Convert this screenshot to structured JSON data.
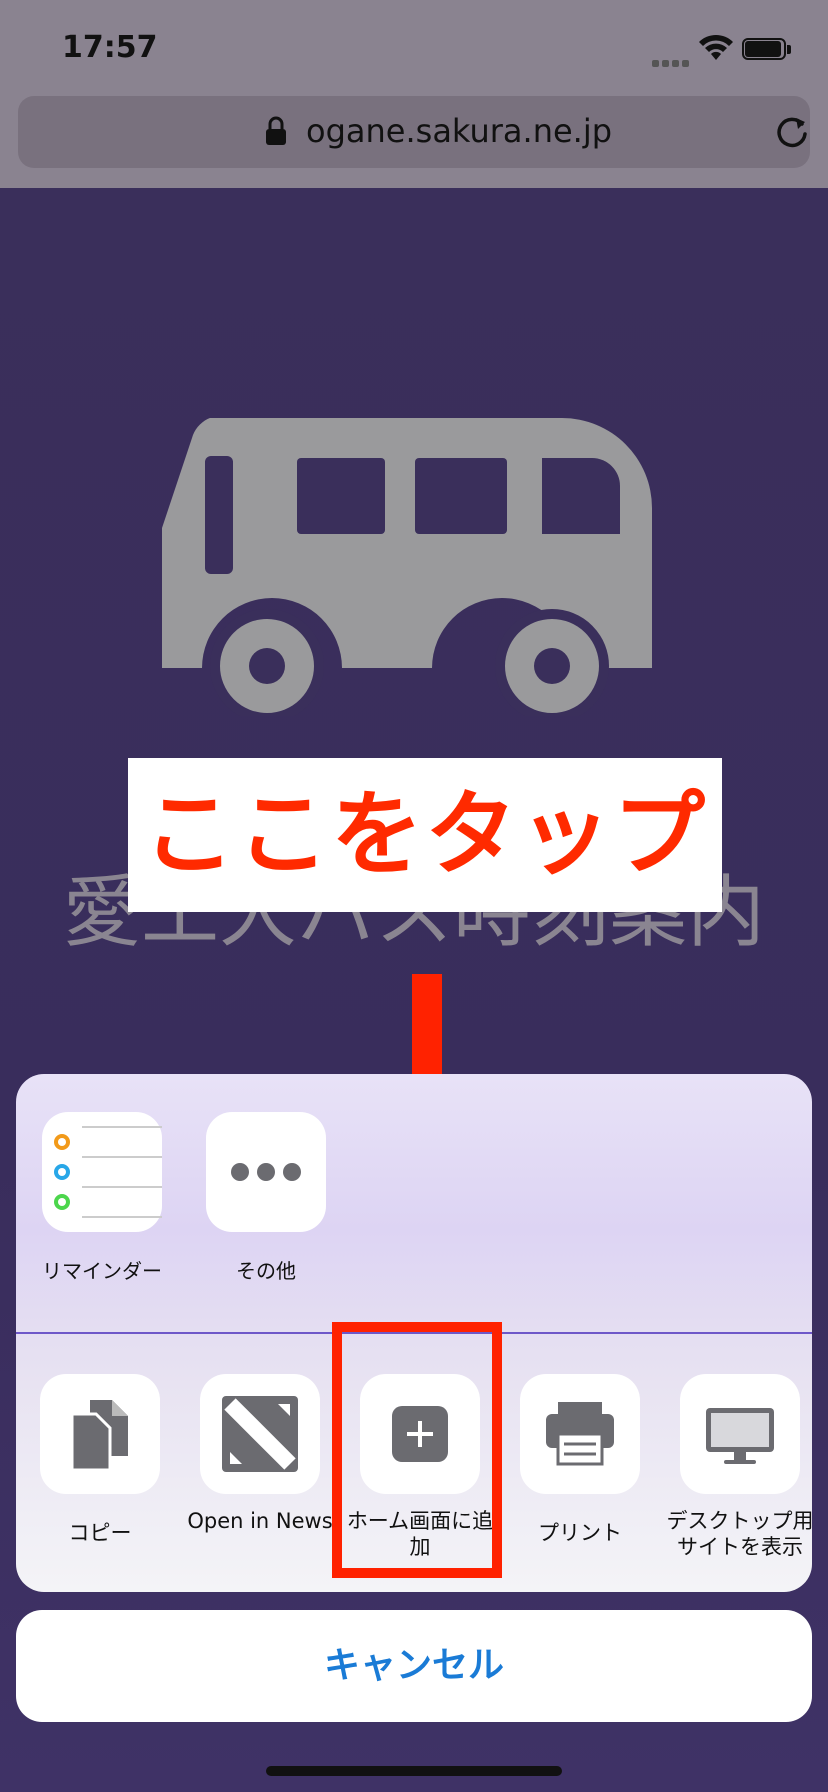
{
  "status_bar": {
    "time": "17:57"
  },
  "browser": {
    "url": "ogane.sakura.ne.jp"
  },
  "page": {
    "title": "愛工大バス時刻案内"
  },
  "annotation": {
    "text": "ここをタップ",
    "color": "#ff2200"
  },
  "share_sheet": {
    "apps": [
      {
        "label": "リマインダー",
        "icon": "reminders-icon"
      },
      {
        "label": "その他",
        "icon": "more-icon"
      }
    ],
    "actions": [
      {
        "label": "コピー",
        "icon": "copy-icon"
      },
      {
        "label": "Open in News",
        "icon": "news-icon"
      },
      {
        "label": "ホーム画面に追加",
        "icon": "add-square-icon"
      },
      {
        "label": "プリント",
        "icon": "printer-icon"
      },
      {
        "label": "デスクトップ用サイトを表示",
        "icon": "desktop-icon"
      }
    ],
    "cancel_label": "キャンセル"
  },
  "colors": {
    "accent": "#1a7bd6",
    "annotation_red": "#ff2200",
    "page_bg": "#3a2f5b"
  }
}
